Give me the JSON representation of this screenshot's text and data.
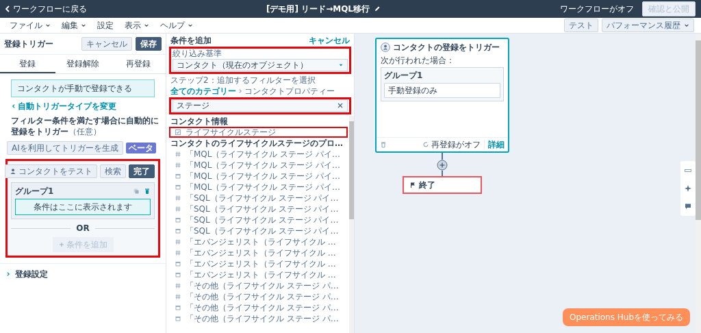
{
  "top_bar": {
    "back_link": "ワークフローに戻る",
    "title": "[デモ用] リード→MQL移行",
    "status": "ワークフローがオフ",
    "publish_button": {
      "label": "確認と公開",
      "disabled": true
    }
  },
  "menu_bar": {
    "menus": [
      {
        "label": "ファイル",
        "has_menu": true
      },
      {
        "label": "編集",
        "has_menu": true
      },
      {
        "label": "設定",
        "has_menu": false
      },
      {
        "label": "表示",
        "has_menu": true
      },
      {
        "label": "ヘルプ",
        "has_menu": true
      }
    ],
    "test_button": "テスト",
    "history_button": "パフォーマンス履歴"
  },
  "trigger_panel": {
    "title": "登録トリガー",
    "cancel_button": "キャンセル",
    "save_button": "保存",
    "tabs": [
      {
        "label": "登録",
        "selected": true
      },
      {
        "label": "登録解除",
        "selected": false
      },
      {
        "label": "再登録",
        "selected": false
      }
    ],
    "trigger_type": "コンタクトが手動で登録できる",
    "change_link": "自動トリガータイプを変更",
    "heading": "**フィルター条件を満たす場合に自動的に登録をトリガー**（任意）",
    "ai_button": "AIを利用してトリガーを生成",
    "beta_badge": "ベータ",
    "filter_editor": {
      "highlighted": true,
      "test_button": "コンタクトをテスト",
      "search_button": "検索",
      "done_button": "完了",
      "group_title": "グループ1",
      "empty_text": "条件はここに表示されます",
      "or_label": "OR",
      "add_button": {
        "label": "条件を追加",
        "disabled": true
      }
    },
    "settings_section": {
      "label": "登録設定",
      "expanded": false
    }
  },
  "filter_panel": {
    "title": "条件を追加",
    "cancel_link": "キャンセル",
    "select": {
      "label": "絞り込み基準",
      "value": "コンタクト（現在のオブジェクト）",
      "highlighted": true
    },
    "step_text": "ステップ2：追加するフィルターを選択",
    "breadcrumb": [
      "全てのカテゴリー",
      "コンタクトプロパティー"
    ],
    "search": {
      "value": "ステージ",
      "highlighted": true
    },
    "sections": [
      {
        "title": "コンタクト情報",
        "items": [
          {
            "label": "ライフサイクルステージ",
            "kind": "property",
            "highlighted": true
          }
        ]
      },
      {
        "title": "コンタクトのライフサイクルステージのプロ…",
        "items": [
          {
            "label": "「MQL（ライフサイクル ステージ パイ…",
            "kind": "number",
            "highlighted": false
          },
          {
            "label": "「MQL（ライフサイクル ステージ パイ…",
            "kind": "number",
            "highlighted": false
          },
          {
            "label": "「MQL（ライフサイクル ステージ パイ…",
            "kind": "date",
            "highlighted": false
          },
          {
            "label": "「MQL（ライフサイクル ステージ パイ…",
            "kind": "date",
            "highlighted": false
          },
          {
            "label": "「SQL（ライフサイクル ステージ パイ…",
            "kind": "number",
            "highlighted": false
          },
          {
            "label": "「SQL（ライフサイクル ステージ パイ…",
            "kind": "number",
            "highlighted": false
          },
          {
            "label": "「SQL（ライフサイクル ステージ パイ…",
            "kind": "date",
            "highlighted": false
          },
          {
            "label": "「SQL（ライフサイクル ステージ パイ…",
            "kind": "date",
            "highlighted": false
          },
          {
            "label": "「エバンジェリスト（ライフサイクル …",
            "kind": "number",
            "highlighted": false
          },
          {
            "label": "「エバンジェリスト（ライフサイクル …",
            "kind": "number",
            "highlighted": false
          },
          {
            "label": "「エバンジェリスト（ライフサイクル …",
            "kind": "date",
            "highlighted": false
          },
          {
            "label": "「エバンジェリスト（ライフサイクル …",
            "kind": "date",
            "highlighted": false
          },
          {
            "label": "「その他（ライフサイクル ステージ パ…",
            "kind": "number",
            "highlighted": false
          },
          {
            "label": "「その他（ライフサイクル ステージ パ…",
            "kind": "number",
            "highlighted": false
          },
          {
            "label": "「その他（ライフサイクル ステージ パ…",
            "kind": "date",
            "highlighted": false
          },
          {
            "label": "「その他（ライフサイクル ステージ パ…",
            "kind": "date",
            "highlighted": false
          }
        ]
      }
    ]
  },
  "canvas": {
    "trigger_card": {
      "title": "コンタクトの登録をトリガー",
      "condition_text": "次が行われた場合：",
      "group_title": "グループ1",
      "condition": "手動登録のみ",
      "reenroll_status": "再登録がオフ",
      "details_link": "詳細"
    },
    "end_node": {
      "label": "終了",
      "highlighted": true
    },
    "promo_button": "Operations Hubを使ってみる"
  }
}
